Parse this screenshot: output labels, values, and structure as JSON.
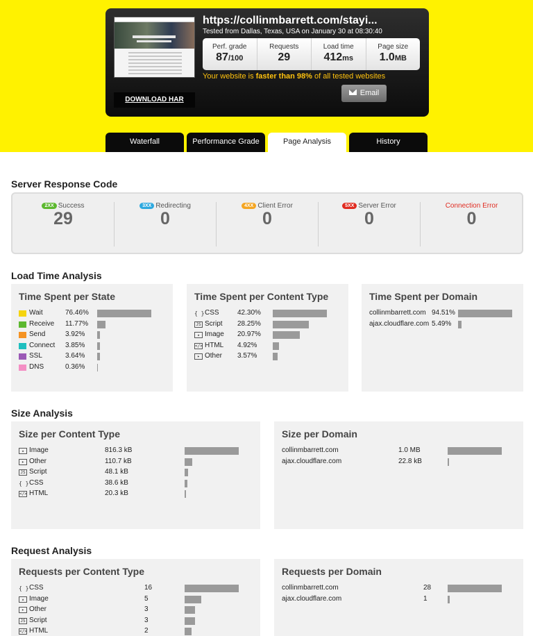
{
  "summary": {
    "url": "https://collinmbarrett.com/stayi...",
    "tested_from": "Tested from Dallas, Texas, USA on January 30 at 08:30:40",
    "download_label": "DOWNLOAD HAR",
    "metrics": [
      {
        "label": "Perf. grade",
        "value": "87",
        "unit": "/100"
      },
      {
        "label": "Requests",
        "value": "29",
        "unit": ""
      },
      {
        "label": "Load time",
        "value": "412",
        "unit": "ms"
      },
      {
        "label": "Page size",
        "value": "1.0",
        "unit": "MB"
      }
    ],
    "faster_prefix": "Your website is ",
    "faster_bold": "faster than 98%",
    "faster_suffix": " of all tested websites",
    "email_label": "Email"
  },
  "tabs": [
    "Waterfall",
    "Performance Grade",
    "Page Analysis",
    "History"
  ],
  "active_tab": "Page Analysis",
  "server_response": {
    "title": "Server Response Code",
    "codes": [
      {
        "badge": "2XX",
        "label": "Success",
        "count": "29",
        "color": "#5cb82f"
      },
      {
        "badge": "3XX",
        "label": "Redirecting",
        "count": "0",
        "color": "#2ea9df"
      },
      {
        "badge": "4XX",
        "label": "Client Error",
        "count": "0",
        "color": "#f5a623"
      },
      {
        "badge": "5XX",
        "label": "Server Error",
        "count": "0",
        "color": "#e02b20"
      },
      {
        "badge": "",
        "label": "Connection Error",
        "count": "0",
        "color": "#e02b20"
      }
    ]
  },
  "load_time": {
    "title": "Load Time Analysis",
    "per_state": {
      "title": "Time Spent per State",
      "rows": [
        {
          "label": "Wait",
          "pct": "76.46%",
          "value": 76.46,
          "color": "#f5d40f"
        },
        {
          "label": "Receive",
          "pct": "11.77%",
          "value": 11.77,
          "color": "#5cb82f"
        },
        {
          "label": "Send",
          "pct": "3.92%",
          "value": 3.92,
          "color": "#f59323"
        },
        {
          "label": "Connect",
          "pct": "3.85%",
          "value": 3.85,
          "color": "#1fbfbf"
        },
        {
          "label": "SSL",
          "pct": "3.64%",
          "value": 3.64,
          "color": "#9b59b6"
        },
        {
          "label": "DNS",
          "pct": "0.36%",
          "value": 0.36,
          "color": "#f48fc4"
        }
      ]
    },
    "per_content": {
      "title": "Time Spent per Content Type",
      "rows": [
        {
          "icon": "css-icon",
          "label": "CSS",
          "pct": "42.30%",
          "value": 42.3
        },
        {
          "icon": "script-icon",
          "label": "Script",
          "pct": "28.25%",
          "value": 28.25
        },
        {
          "icon": "image-icon",
          "label": "Image",
          "pct": "20.97%",
          "value": 20.97
        },
        {
          "icon": "html-icon",
          "label": "HTML",
          "pct": "4.92%",
          "value": 4.92
        },
        {
          "icon": "other-icon",
          "label": "Other",
          "pct": "3.57%",
          "value": 3.57
        }
      ]
    },
    "per_domain": {
      "title": "Time Spent per Domain",
      "rows": [
        {
          "label": "collinmbarrett.com",
          "pct": "94.51%",
          "value": 94.51
        },
        {
          "label": "ajax.cloudflare.com",
          "pct": "5.49%",
          "value": 5.49
        }
      ]
    }
  },
  "size": {
    "title": "Size Analysis",
    "per_content": {
      "title": "Size per Content Type",
      "rows": [
        {
          "icon": "image-icon",
          "label": "Image",
          "size": "816.3 kB",
          "value": 816.3
        },
        {
          "icon": "other-icon",
          "label": "Other",
          "size": "110.7 kB",
          "value": 110.7
        },
        {
          "icon": "script-icon",
          "label": "Script",
          "size": "48.1 kB",
          "value": 48.1
        },
        {
          "icon": "css-icon",
          "label": "CSS",
          "size": "38.6 kB",
          "value": 38.6
        },
        {
          "icon": "html-icon",
          "label": "HTML",
          "size": "20.3 kB",
          "value": 20.3
        }
      ]
    },
    "per_domain": {
      "title": "Size per Domain",
      "rows": [
        {
          "label": "collinmbarrett.com",
          "size": "1.0 MB",
          "value": 1024
        },
        {
          "label": "ajax.cloudflare.com",
          "size": "22.8 kB",
          "value": 22.8
        }
      ]
    }
  },
  "requests": {
    "title": "Request Analysis",
    "per_content": {
      "title": "Requests per Content Type",
      "rows": [
        {
          "icon": "css-icon",
          "label": "CSS",
          "count": "16",
          "value": 16
        },
        {
          "icon": "image-icon",
          "label": "Image",
          "count": "5",
          "value": 5
        },
        {
          "icon": "other-icon",
          "label": "Other",
          "count": "3",
          "value": 3
        },
        {
          "icon": "script-icon",
          "label": "Script",
          "count": "3",
          "value": 3
        },
        {
          "icon": "html-icon",
          "label": "HTML",
          "count": "2",
          "value": 2
        }
      ]
    },
    "per_domain": {
      "title": "Requests per Domain",
      "rows": [
        {
          "label": "collinmbarrett.com",
          "count": "28",
          "value": 28
        },
        {
          "label": "ajax.cloudflare.com",
          "count": "1",
          "value": 1
        }
      ]
    }
  }
}
